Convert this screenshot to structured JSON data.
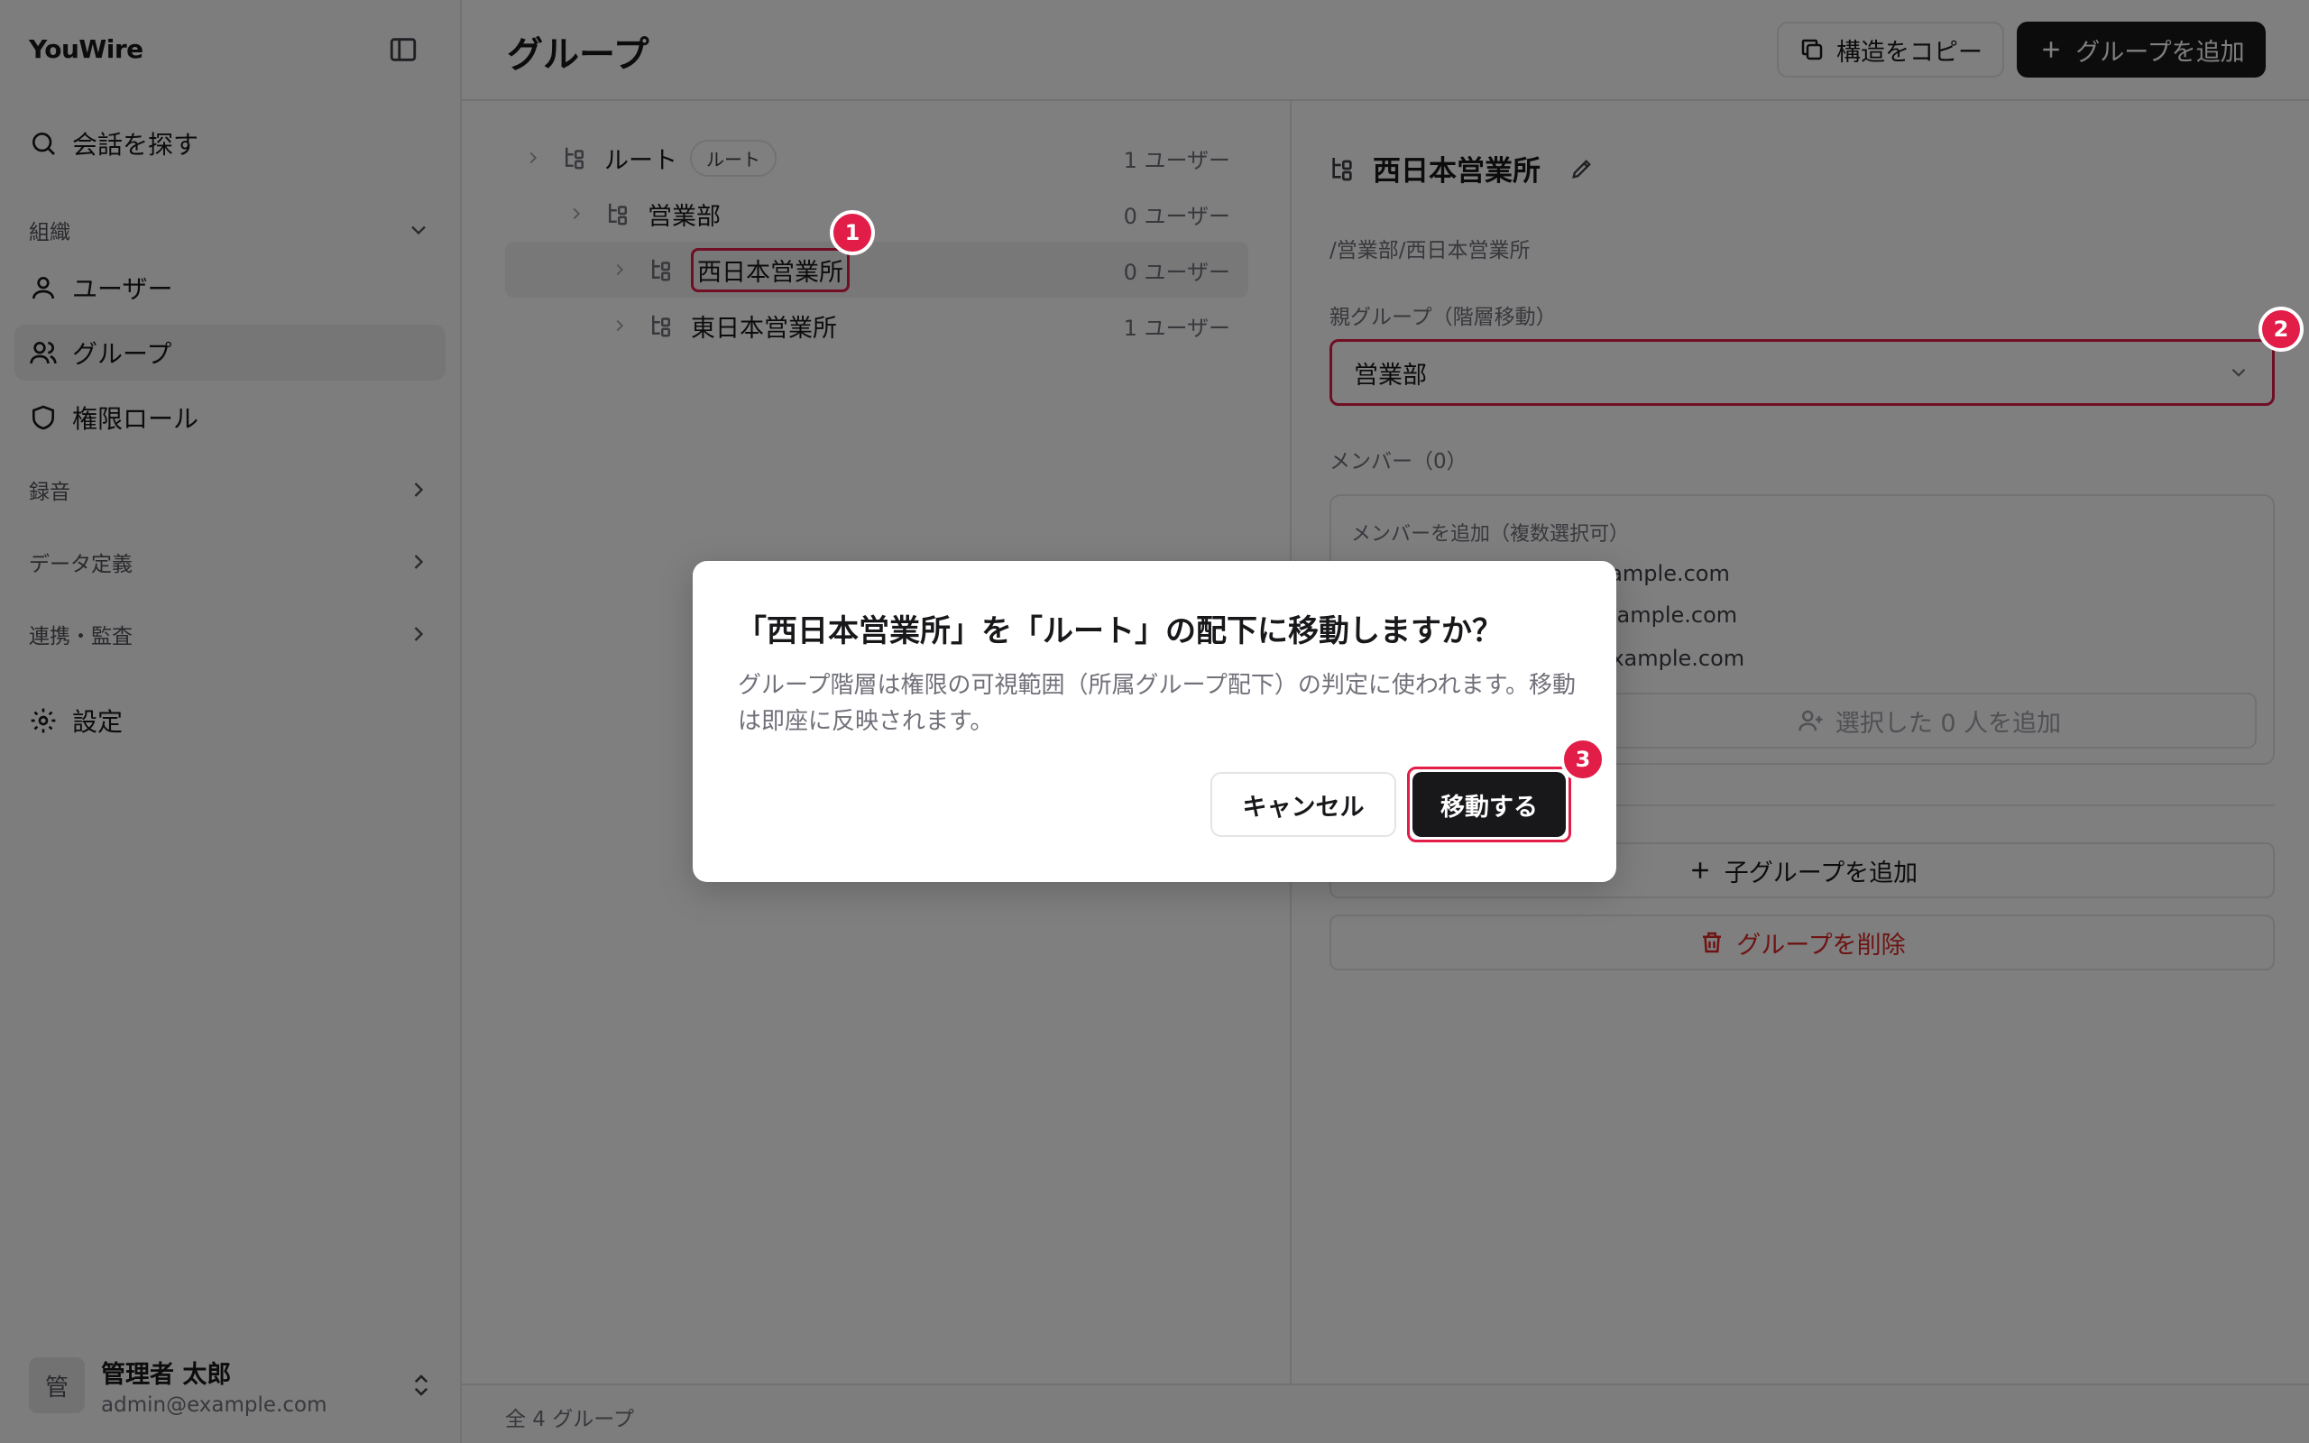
{
  "sidebar": {
    "brand": "YouWire",
    "search_label": "会話を探す",
    "org_section": "組織",
    "items": [
      {
        "label": "ユーザー",
        "icon": "user-icon"
      },
      {
        "label": "グループ",
        "icon": "users-icon",
        "active": true
      },
      {
        "label": "権限ロール",
        "icon": "shield-icon"
      }
    ],
    "sections": [
      {
        "label": "録音"
      },
      {
        "label": "データ定義"
      },
      {
        "label": "連携・監査"
      }
    ],
    "settings_label": "設定",
    "user": {
      "avatar_char": "管",
      "name": "管理者 太郎",
      "email": "admin@example.com"
    }
  },
  "header": {
    "title": "グループ",
    "copy_label": "構造をコピー",
    "add_label": "グループを追加"
  },
  "tree": [
    {
      "name": "ルート",
      "badge": "ルート",
      "count": "1 ユーザー"
    },
    {
      "name": "営業部",
      "count": "0 ユーザー"
    },
    {
      "name": "西日本営業所",
      "count": "0 ユーザー",
      "selected": true
    },
    {
      "name": "東日本営業所",
      "count": "1 ユーザー"
    }
  ],
  "detail": {
    "title": "西日本営業所",
    "path": "/営業部/西日本営業所",
    "parent_label": "親グループ（階層移動）",
    "parent_value": "営業部",
    "members_label": "メンバー（0）",
    "add_members_label": "メンバーを追加（複数選択可）",
    "visible_emails": [
      "xample.com",
      "example.com",
      "@example.com"
    ],
    "add_selected_label": "選択した 0 人を追加",
    "add_child_label": "子グループを追加",
    "delete_label": "グループを削除"
  },
  "footer": {
    "total": "全 4 グループ"
  },
  "dialog": {
    "title": "「西日本営業所」を「ルート」の配下に移動しますか？",
    "description": "グループ階層は権限の可視範囲（所属グループ配下）の判定に使われます。移動は即座に反映されます。",
    "cancel_label": "キャンセル",
    "confirm_label": "移動する"
  },
  "steps": [
    "1",
    "2",
    "3"
  ],
  "colors": {
    "accent_highlight": "#e11d48",
    "dark_button": "#18181b",
    "danger": "#dc2626"
  }
}
